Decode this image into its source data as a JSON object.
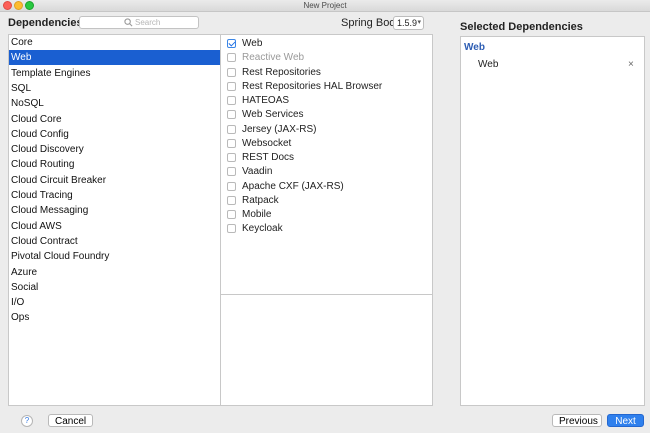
{
  "window": {
    "title": "New Project"
  },
  "dependencies_header": "Dependencies",
  "search": {
    "placeholder": "Search",
    "value": ""
  },
  "spring_boot": {
    "label": "Spring Boot",
    "version": "1.5.9"
  },
  "selected_header": "Selected Dependencies",
  "categories": [
    "Core",
    "Web",
    "Template Engines",
    "SQL",
    "NoSQL",
    "Cloud Core",
    "Cloud Config",
    "Cloud Discovery",
    "Cloud Routing",
    "Cloud Circuit Breaker",
    "Cloud Tracing",
    "Cloud Messaging",
    "Cloud AWS",
    "Cloud Contract",
    "Pivotal Cloud Foundry",
    "Azure",
    "Social",
    "I/O",
    "Ops"
  ],
  "selected_category": "Web",
  "dependencies": [
    {
      "label": "Web",
      "checked": true,
      "enabled": true
    },
    {
      "label": "Reactive Web",
      "checked": false,
      "enabled": false
    },
    {
      "label": "Rest Repositories",
      "checked": false,
      "enabled": true
    },
    {
      "label": "Rest Repositories HAL Browser",
      "checked": false,
      "enabled": true
    },
    {
      "label": "HATEOAS",
      "checked": false,
      "enabled": true
    },
    {
      "label": "Web Services",
      "checked": false,
      "enabled": true
    },
    {
      "label": "Jersey (JAX-RS)",
      "checked": false,
      "enabled": true
    },
    {
      "label": "Websocket",
      "checked": false,
      "enabled": true
    },
    {
      "label": "REST Docs",
      "checked": false,
      "enabled": true
    },
    {
      "label": "Vaadin",
      "checked": false,
      "enabled": true
    },
    {
      "label": "Apache CXF (JAX-RS)",
      "checked": false,
      "enabled": true
    },
    {
      "label": "Ratpack",
      "checked": false,
      "enabled": true
    },
    {
      "label": "Mobile",
      "checked": false,
      "enabled": true
    },
    {
      "label": "Keycloak",
      "checked": false,
      "enabled": true
    }
  ],
  "selected_dependencies": {
    "group": "Web",
    "items": [
      {
        "label": "Web",
        "remove_icon": "×"
      }
    ]
  },
  "buttons": {
    "help": "?",
    "cancel": "Cancel",
    "previous": "Previous",
    "next": "Next"
  },
  "colors": {
    "selection": "#1a5fd1",
    "primary_button": "#2f80ed",
    "group_label": "#2d5db3"
  }
}
